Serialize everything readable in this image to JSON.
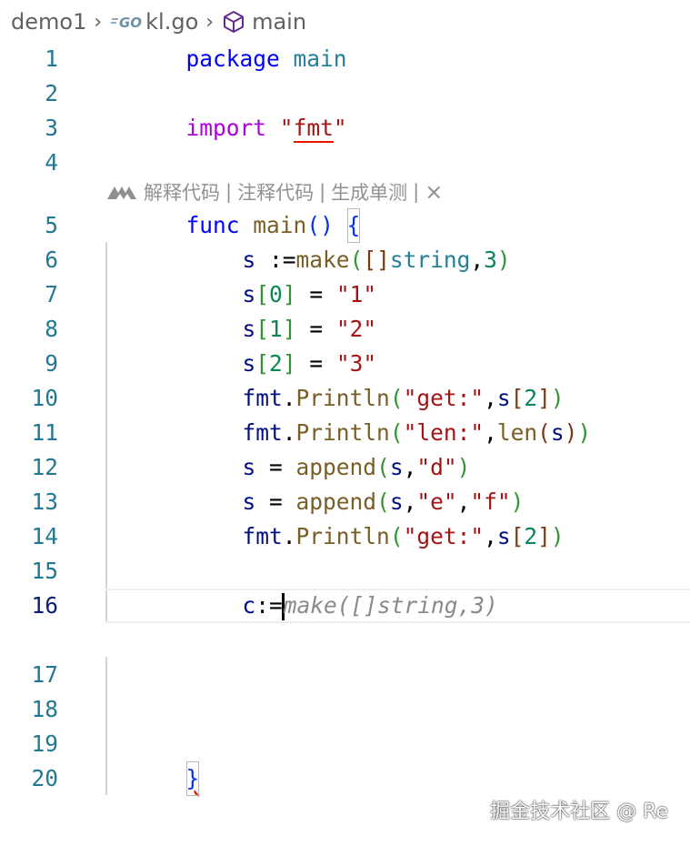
{
  "breadcrumb": {
    "folder": "demo1",
    "file_icon": "go-file-icon",
    "file": "kl.go",
    "symbol_icon": "cube-icon",
    "symbol": "main"
  },
  "codelens": {
    "icon": "ai-assistant-icon",
    "explain": "解释代码",
    "comment": "注释代码",
    "test": "生成单测",
    "sep": "|",
    "close": "×"
  },
  "lines": [
    {
      "n": "1",
      "t": [
        "package",
        " ",
        "main"
      ]
    },
    {
      "n": "2"
    },
    {
      "n": "3",
      "t": [
        "import",
        " ",
        "\"",
        "fmt",
        "\""
      ]
    },
    {
      "n": "4"
    },
    {
      "n": "5",
      "t": [
        "func",
        " ",
        "main",
        "()",
        " ",
        "{"
      ]
    },
    {
      "n": "6",
      "t": [
        "s",
        " :=",
        "make",
        "(",
        "[]",
        "string",
        ",",
        "3",
        ")"
      ]
    },
    {
      "n": "7",
      "t": [
        "s",
        "[",
        "0",
        "]",
        " = ",
        "\"1\""
      ]
    },
    {
      "n": "8",
      "t": [
        "s",
        "[",
        "1",
        "]",
        " = ",
        "\"2\""
      ]
    },
    {
      "n": "9",
      "t": [
        "s",
        "[",
        "2",
        "]",
        " = ",
        "\"3\""
      ]
    },
    {
      "n": "10",
      "t": [
        "fmt",
        ".",
        "Println",
        "(",
        "\"get:\"",
        ",",
        "s",
        "[",
        "2",
        "]",
        ")"
      ]
    },
    {
      "n": "11",
      "t": [
        "fmt",
        ".",
        "Println",
        "(",
        "\"len:\"",
        ",",
        "len",
        "(",
        "s",
        ")",
        ")"
      ]
    },
    {
      "n": "12",
      "t": [
        "s",
        " = ",
        "append",
        "(",
        "s",
        ",",
        "\"d\"",
        ")"
      ]
    },
    {
      "n": "13",
      "t": [
        "s",
        " = ",
        "append",
        "(",
        "s",
        ",",
        "\"e\"",
        ",",
        "\"f\"",
        ")"
      ]
    },
    {
      "n": "14",
      "t": [
        "fmt",
        ".",
        "Println",
        "(",
        "\"get:\"",
        ",",
        "s",
        "[",
        "2",
        "]",
        ")"
      ]
    },
    {
      "n": "15"
    },
    {
      "n": "16",
      "t": [
        "c",
        ":="
      ],
      "ghost": "make([]string,3)"
    },
    {
      "n": "17"
    },
    {
      "n": "18"
    },
    {
      "n": "19"
    },
    {
      "n": "20",
      "t": [
        "}"
      ]
    }
  ],
  "watermark": "掘金技术社区 @ Re"
}
